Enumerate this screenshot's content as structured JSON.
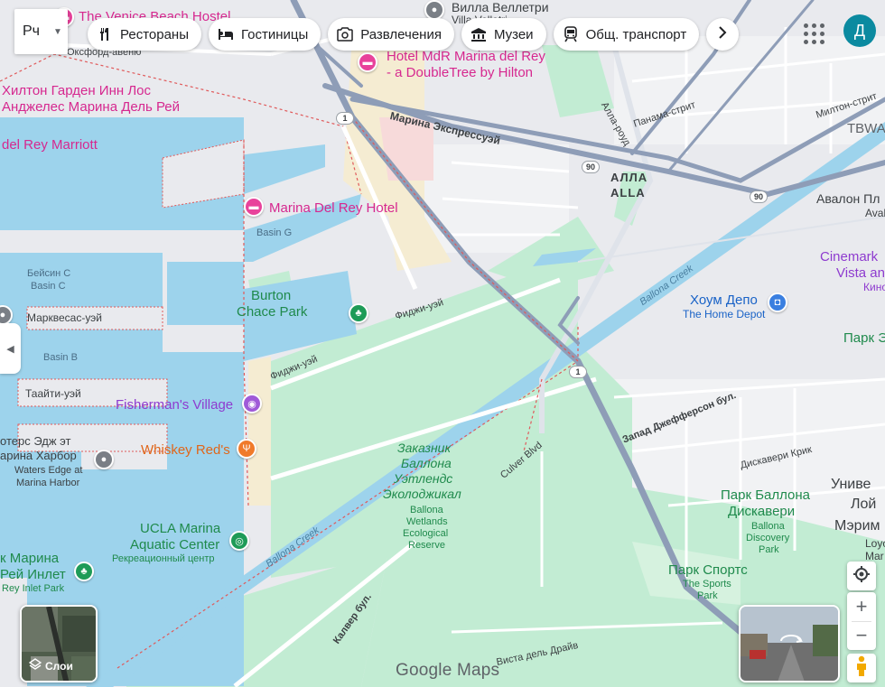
{
  "search": {
    "text": "Рч"
  },
  "chips": [
    {
      "label": "Рестораны",
      "icon": "fork-knife-icon"
    },
    {
      "label": "Гостиницы",
      "icon": "bed-icon"
    },
    {
      "label": "Развлечения",
      "icon": "camera-icon"
    },
    {
      "label": "Музеи",
      "icon": "museum-icon"
    },
    {
      "label": "Общ. транспорт",
      "icon": "train-icon"
    }
  ],
  "account": {
    "initial": "Д"
  },
  "layers": {
    "label": "Слои"
  },
  "brand": {
    "name": "Google Maps"
  },
  "colors": {
    "water": "#9dd3ec",
    "park": "#c2ecd3",
    "land": "#e9eaee",
    "highway": "#8e9db7",
    "pink": "#d6288f"
  },
  "map_labels": {
    "venice_beach_hostel": "The Venice Beach Hostel",
    "villa_velletri": "Вилла Веллетри",
    "villa_velletri_sub": "Villa Velletri",
    "oxford_ave": "Оксфорд-авеню",
    "hotel_mdr_1": "Hotel MdR Marina del Rey",
    "hotel_mdr_2": "- a DoubleTree by Hilton",
    "hilton_1": "Хилтон Гарден Инн Лос",
    "hilton_2": "Анджелес Марина Дель Рей",
    "marriott": "del Rey Marriott",
    "marina_expressway": "Марина Экспрессуэй",
    "panama_st": "Панама-стрит",
    "alla_road": "Алла-роуд",
    "milton_st": "Милтон-стрит",
    "tbwa": "TBWA",
    "alla_area": "АЛЛА",
    "alla_area_en": "ALLA",
    "avalon": "Авалон Пл",
    "avalon_sub": "Avalo",
    "marina_del_rey_hotel": "Marina Del Rey Hotel",
    "basin_g": "Basin G",
    "basin_c_ru": "Бейсин С",
    "basin_c": "Basin C",
    "marquesas_way": "Марквесас-уэй",
    "burton_1": "Burton",
    "burton_2": "Chace Park",
    "fiji_way_1": "Фиджи-уэй",
    "fiji_way_2": "Фиджи-уэй",
    "ballona_creek_1": "Ballona Creek",
    "ballona_creek_2": "Ballona Creek",
    "cinemark_1": "Cinemark",
    "cinemark_2": "Vista an",
    "cinemark_3": "Кино",
    "home_depot": "Хоум Депо",
    "home_depot_sub": "The Home Depot",
    "park_right": "Парк Э",
    "basin_b": "Basin B",
    "tahiti_way": "Таайти-уэй",
    "fishermans": "Fisherman's Village",
    "jefferson": "Запад Джефферсон бул.",
    "discovery_creek": "Дискавери Крик",
    "edge_1": "отерс Эдж эт",
    "edge_2": "арина Харбор",
    "edge_sub_1": "Waters Edge at",
    "edge_sub_2": "Marina Harbor",
    "whiskey": "Whiskey Red's",
    "reserve_1": "Заказник",
    "reserve_2": "Баллона",
    "reserve_3": "Уэтлендс",
    "reserve_4": "Эколоджикал",
    "reserve_en_1": "Ballona",
    "reserve_en_2": "Wetlands",
    "reserve_en_3": "Ecological",
    "reserve_en_4": "Reserve",
    "culver_blvd_en": "Culver Blvd",
    "univ_1": "Униве",
    "univ_2": "Лой",
    "univ_3": "Мэрим",
    "univ_sub_1": "Loyo",
    "univ_sub_2": "Mar",
    "discovery_park_1": "Парк Баллона",
    "discovery_park_2": "Дискавери",
    "discovery_sub_1": "Ballona",
    "discovery_sub_2": "Discovery",
    "discovery_sub_3": "Park",
    "ucla_1": "UCLA Marina",
    "ucla_2": "Aquatic Center",
    "ucla_sub": "Рекреационный центр",
    "inlet_1": "к Марина",
    "inlet_2": "Рей Инлет",
    "inlet_sub": "Rey Inlet Park",
    "sports_park_1": "Парк Спортс",
    "sports_sub_1": "The Sports",
    "sports_sub_2": "Park",
    "culver_blvd_ru": "Калвер бул.",
    "vista_drive": "Виста дель Драйв",
    "shield_1": "1",
    "shield_90": "90"
  }
}
